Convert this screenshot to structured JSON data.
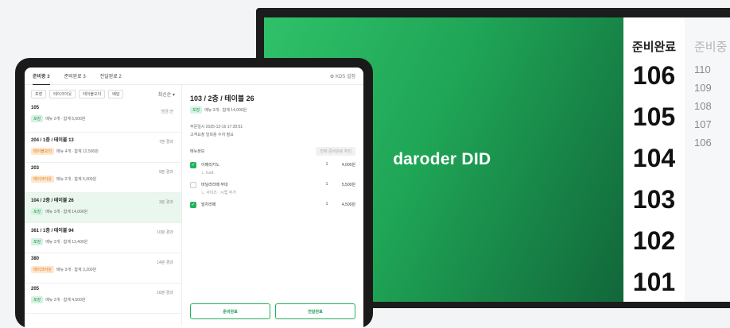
{
  "tv": {
    "logo_mark": "b",
    "logo_text": "aroder DID",
    "ready": {
      "heading": "준비완료",
      "numbers": [
        "106",
        "105",
        "104",
        "103",
        "102",
        "101"
      ]
    },
    "preparing": {
      "heading": "준비중",
      "numbers": [
        "110",
        "109",
        "108",
        "107",
        "106"
      ]
    }
  },
  "tablet": {
    "tabs": [
      "준비중 3",
      "준비완료 3",
      "전달완료 2"
    ],
    "kds_label": "⚙ KDS 설정",
    "filters": [
      "포장",
      "테이크아웃",
      "테이블오더",
      "배달"
    ],
    "sort_label": "최신순 ▾",
    "orders": [
      {
        "title": "105",
        "time": "방금 전",
        "badge": "포장",
        "badge_color": "green",
        "desc": "메뉴 2개 · 합계 5,000원"
      },
      {
        "title": "204 / 1층 / 테이블 13",
        "time": "7분 경과",
        "badge": "테이블오더",
        "badge_color": "orange",
        "desc": "메뉴 4개 · 합계 12,500원"
      },
      {
        "title": "203",
        "time": "9분 경과",
        "badge": "테이크아웃",
        "badge_color": "orange",
        "desc": "메뉴 2개 · 합계 5,000원"
      },
      {
        "title": "104 / 2층 / 테이블 26",
        "time": "3분 경과",
        "badge": "포장",
        "badge_color": "green",
        "desc": "메뉴 3개 · 합계 14,000원"
      },
      {
        "title": "361 / 1층 / 테이블 94",
        "time": "10분 경과",
        "badge": "포장",
        "badge_color": "green",
        "desc": "메뉴 3개 · 합계 13,400원"
      },
      {
        "title": "380",
        "time": "14분 경과",
        "badge": "테이크아웃",
        "badge_color": "orange",
        "desc": "메뉴 3개 · 합계 3,200원"
      },
      {
        "title": "205",
        "time": "16분 경과",
        "badge": "포장",
        "badge_color": "green",
        "desc": "메뉴 2개 · 합계 4,500원"
      }
    ],
    "detail": {
      "title": "103 / 2층 / 테이블 26",
      "badge": "포장",
      "meta": "메뉴 3개 · 합계 14,000원",
      "order_time": "주문일시   2025-12-16 17:30:51",
      "order_type": "고객요청   일회용 수저 필요",
      "menu_heading": "메뉴정보",
      "all_done": "전체 준비완료 처리",
      "items": [
        {
          "checked": true,
          "name": "아메리카노",
          "sub": "ㄴ Iced",
          "qty": "1",
          "price": "4,000원"
        },
        {
          "checked": false,
          "name": "바닐라라떼 무대",
          "sub": "ㄴ 사이즈 · 시럽 추가",
          "qty": "1",
          "price": "5,500원"
        },
        {
          "checked": true,
          "name": "말차라떼",
          "sub": "",
          "qty": "1",
          "price": "4,500원"
        }
      ],
      "btn_ready": "준비완료",
      "btn_delivered": "전달완료"
    }
  }
}
